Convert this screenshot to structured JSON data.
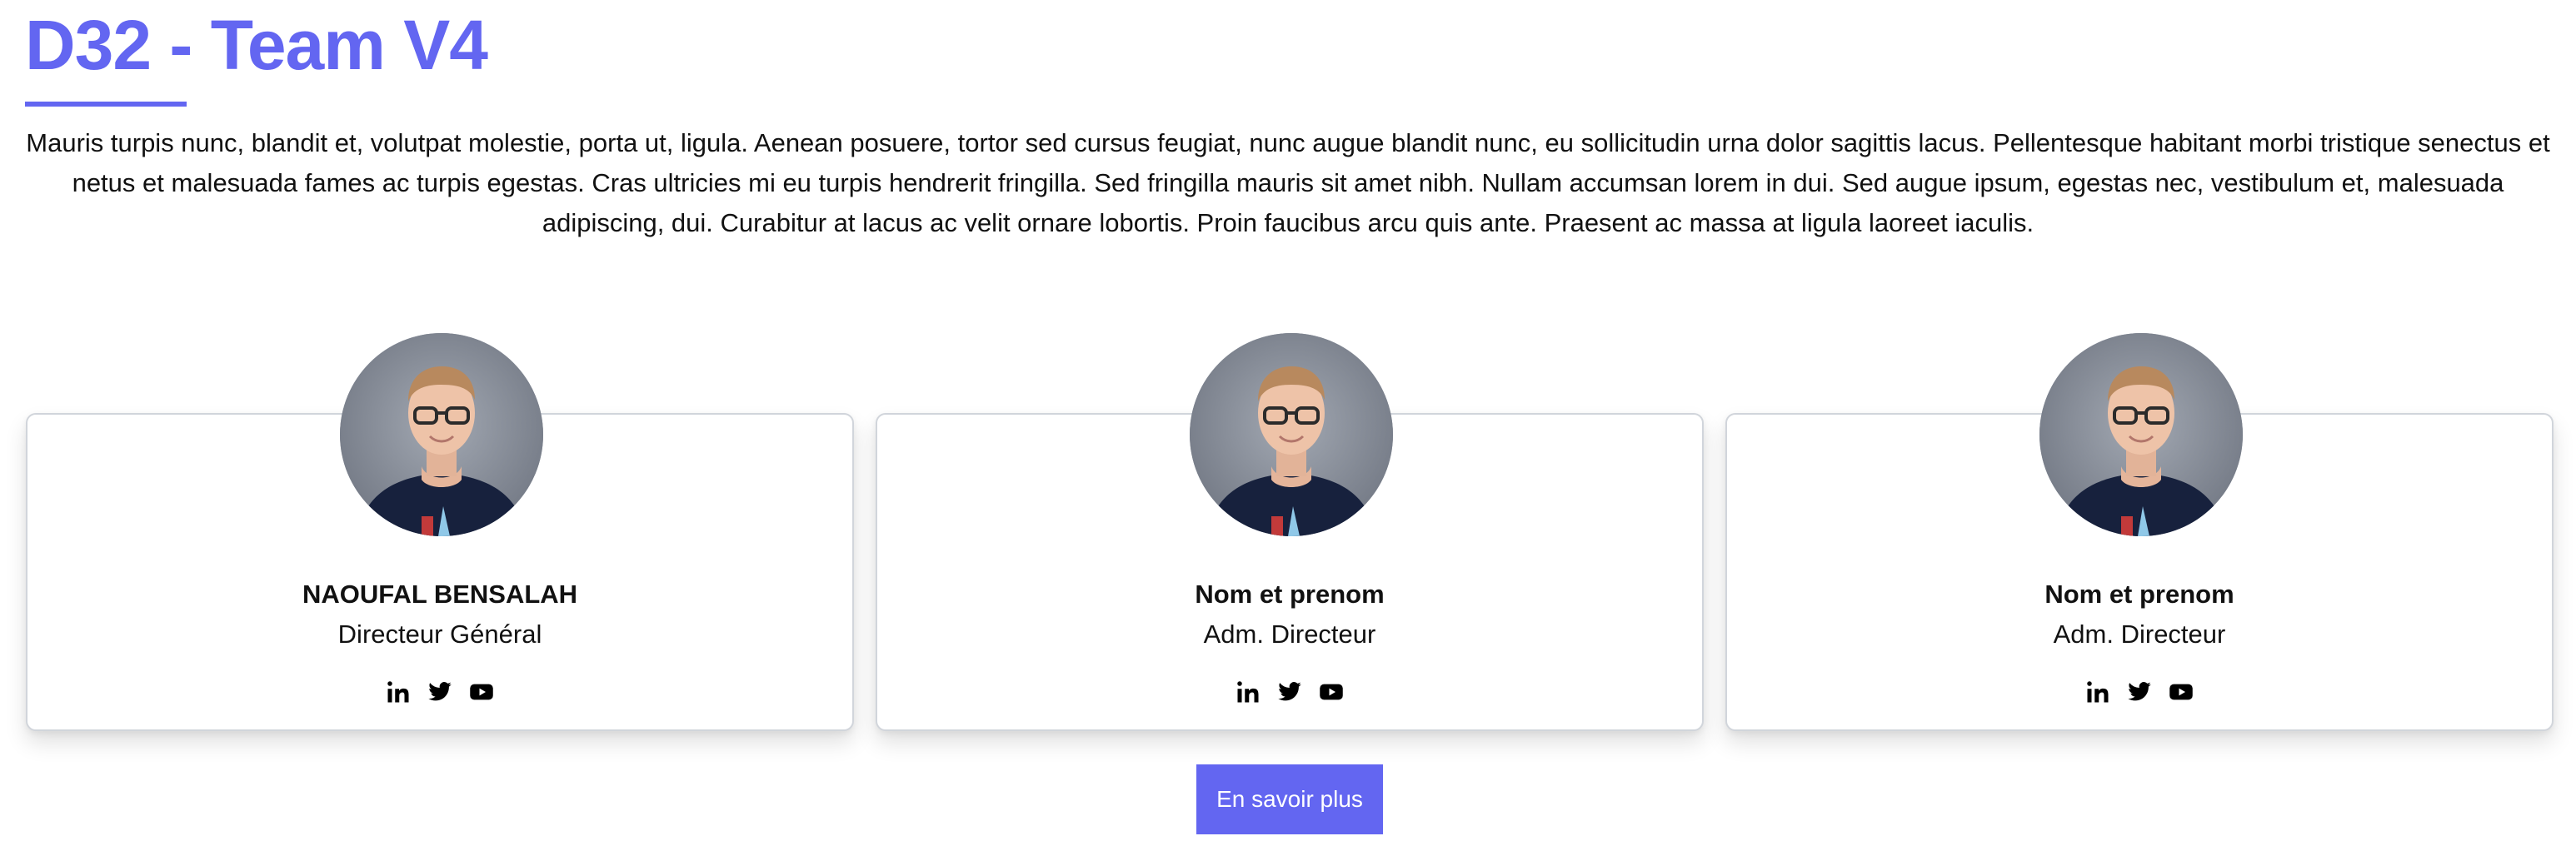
{
  "page": {
    "title": "D32 - Team V4",
    "intro": "Mauris turpis nunc, blandit et, volutpat molestie, porta ut, ligula. Aenean posuere, tortor sed cursus feugiat, nunc augue blandit nunc, eu sollicitudin urna dolor sagittis lacus. Pellentesque habitant morbi tristique senectus et netus et malesuada fames ac turpis egestas. Cras ultricies mi eu turpis hendrerit fringilla. Sed fringilla mauris sit amet nibh. Nullam accumsan lorem in dui. Sed augue ipsum, egestas nec, vestibulum et, malesuada adipiscing, dui. Curabitur at lacus ac velit ornare lobortis. Proin faucibus arcu quis ante. Praesent ac massa at ligula laoreet iaculis."
  },
  "team": [
    {
      "name": "NAOUFAL BENSALAH",
      "role": "Directeur Général",
      "socials": [
        "linkedin-icon",
        "twitter-icon",
        "youtube-icon"
      ]
    },
    {
      "name": "Nom et prenom",
      "role": "Adm. Directeur",
      "socials": [
        "linkedin-icon",
        "twitter-icon",
        "youtube-icon"
      ]
    },
    {
      "name": "Nom et prenom",
      "role": "Adm. Directeur",
      "socials": [
        "linkedin-icon",
        "twitter-icon",
        "youtube-icon"
      ]
    }
  ],
  "cta": {
    "label": "En savoir plus"
  },
  "colors": {
    "accent": "#6366f1",
    "text": "#111111",
    "card_border": "#d1d5db"
  }
}
